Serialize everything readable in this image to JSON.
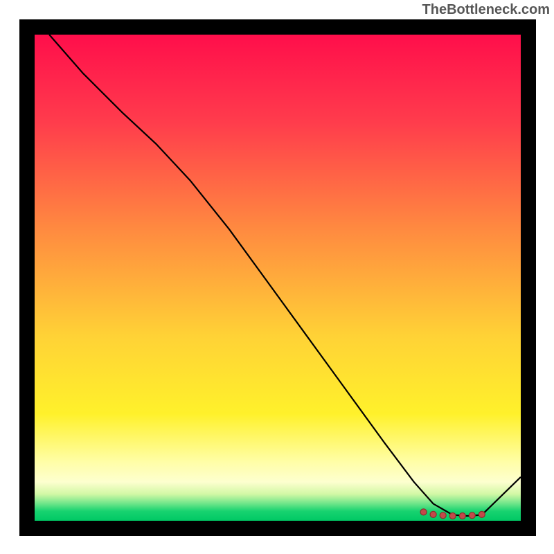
{
  "watermark": "TheBottleneck.com",
  "chart_data": {
    "type": "line",
    "title": "",
    "xlabel": "",
    "ylabel": "",
    "xlim": [
      0,
      100
    ],
    "ylim": [
      0,
      100
    ],
    "grid": false,
    "series": [
      {
        "name": "curve",
        "x": [
          3,
          10,
          18,
          25,
          32,
          40,
          48,
          56,
          64,
          72,
          78,
          82,
          86,
          89,
          92,
          100
        ],
        "y": [
          100,
          92,
          84,
          77.5,
          70,
          60,
          49,
          38,
          27,
          16,
          8,
          3.5,
          1.2,
          1,
          1.2,
          9
        ]
      }
    ],
    "markers": {
      "name": "highlight-range",
      "x": [
        80,
        82,
        84,
        86,
        88,
        90,
        92
      ],
      "y": [
        1.8,
        1.3,
        1.1,
        1.0,
        1.0,
        1.1,
        1.3
      ]
    },
    "background_gradient": {
      "top": "#ff0e4b",
      "mid": "#fff12b",
      "bottom": "#00c864"
    }
  }
}
